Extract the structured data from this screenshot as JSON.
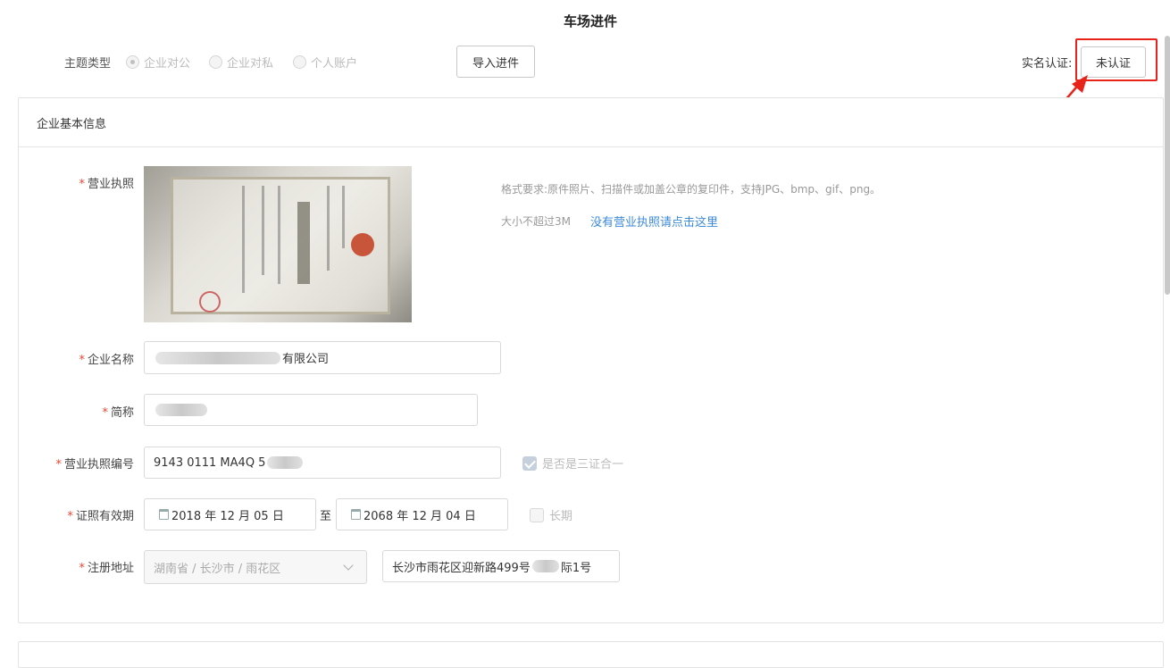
{
  "page_title": "车场进件",
  "topic": {
    "label": "主题类型",
    "options": [
      {
        "label": "企业对公",
        "checked": true
      },
      {
        "label": "企业对私",
        "checked": false
      },
      {
        "label": "个人账户",
        "checked": false
      }
    ]
  },
  "import_button": "导入进件",
  "auth": {
    "label": "实名认证:",
    "button": "未认证"
  },
  "section": {
    "title": "企业基本信息"
  },
  "license": {
    "label": "营业执照",
    "hint_format": "格式要求:原件照片、扫描件或加盖公章的复印件，支持JPG、bmp、gif、png。",
    "hint_size": "大小不超过3M",
    "link": "没有营业执照请点击这里"
  },
  "company_name": {
    "label": "企业名称",
    "value_suffix": "有限公司"
  },
  "short_name": {
    "label": "简称"
  },
  "license_number": {
    "label": "营业执照编号",
    "value": "9143 0111 MA4Q 5",
    "three_in_one": "是否是三证合一"
  },
  "validity": {
    "label": "证照有效期",
    "start": "2018 年 12 月 05 日",
    "to": "至",
    "end": "2068 年 12 月 04 日",
    "long_term": "长期"
  },
  "address": {
    "label": "注册地址",
    "region": "湖南省 / 长沙市 / 雨花区",
    "detail_a": "长沙市雨花区迎新路499号",
    "detail_b": "际1号"
  }
}
